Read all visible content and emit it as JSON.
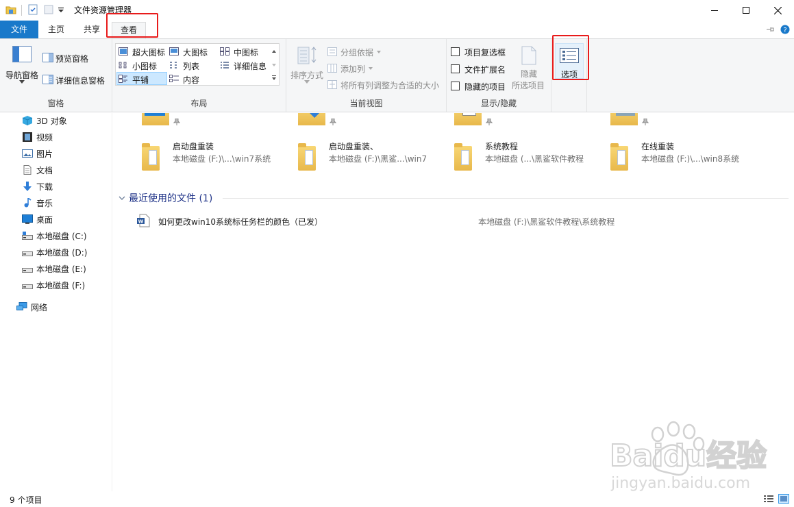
{
  "window": {
    "title": "文件资源管理器",
    "minimize_icon": "minimize-icon",
    "maximize_icon": "maximize-icon",
    "close_icon": "close-icon"
  },
  "tabs": {
    "file": "文件",
    "home": "主页",
    "share": "共享",
    "view": "查看"
  },
  "ribbon": {
    "panes": {
      "navigation_pane": "导航窗格",
      "preview_pane": "预览窗格",
      "details_pane": "详细信息窗格",
      "group_label": "窗格"
    },
    "layout": {
      "extra_large_icons": "超大图标",
      "large_icons": "大图标",
      "medium_icons": "中图标",
      "small_icons": "小图标",
      "list": "列表",
      "details": "详细信息",
      "tiles": "平铺",
      "content": "内容",
      "group_label": "布局"
    },
    "current_view": {
      "sort_by": "排序方式",
      "group_by": "分组依据",
      "add_columns": "添加列",
      "size_all_columns": "将所有列调整为合适的大小",
      "group_label": "当前视图"
    },
    "show_hide": {
      "item_checkboxes": "项目复选框",
      "file_name_extensions": "文件扩展名",
      "hidden_items": "隐藏的项目",
      "hide": "隐藏",
      "selected_items": "所选项目",
      "group_label": "显示/隐藏"
    },
    "options": {
      "label": "选项"
    }
  },
  "nav": {
    "items": [
      {
        "label": "3D 对象",
        "icon": "3d-objects-icon"
      },
      {
        "label": "视频",
        "icon": "videos-icon"
      },
      {
        "label": "图片",
        "icon": "pictures-icon"
      },
      {
        "label": "文档",
        "icon": "documents-icon"
      },
      {
        "label": "下载",
        "icon": "downloads-icon"
      },
      {
        "label": "音乐",
        "icon": "music-icon"
      },
      {
        "label": "桌面",
        "icon": "desktop-icon"
      },
      {
        "label": "本地磁盘 (C:)",
        "icon": "drive-icon"
      },
      {
        "label": "本地磁盘 (D:)",
        "icon": "drive-icon"
      },
      {
        "label": "本地磁盘 (E:)",
        "icon": "drive-icon"
      },
      {
        "label": "本地磁盘 (F:)",
        "icon": "drive-icon"
      },
      {
        "label": "网络",
        "icon": "network-icon"
      }
    ]
  },
  "quick_access": {
    "folders": [
      {
        "name": "启动盘重装",
        "path": "本地磁盘 (F:)\\...\\win7系统"
      },
      {
        "name": "启动盘重装、",
        "path": "本地磁盘 (F:)\\黑鲨...\\win7"
      },
      {
        "name": "系统教程",
        "path": "本地磁盘 (...\\黑鲨软件教程"
      },
      {
        "name": "在线重装",
        "path": "本地磁盘 (F:)\\...\\win8系统"
      }
    ]
  },
  "recent": {
    "header": "最近使用的文件 (1)",
    "files": [
      {
        "name": "如何更改win10系统标任务栏的颜色（已发）",
        "path": "本地磁盘 (F:)\\黑鲨软件教程\\系统教程",
        "icon": "word-document-icon"
      }
    ]
  },
  "status": {
    "item_count": "9 个项目"
  },
  "watermark": {
    "brand": "Baidu经验",
    "url": "jingyan.baidu.com"
  },
  "colors": {
    "file_tab": "#1979ca",
    "highlight_box": "#e81b1b",
    "ribbon_bg": "#f5f6f7",
    "section_header": "#1e3287",
    "selection": "#cce8ff"
  }
}
